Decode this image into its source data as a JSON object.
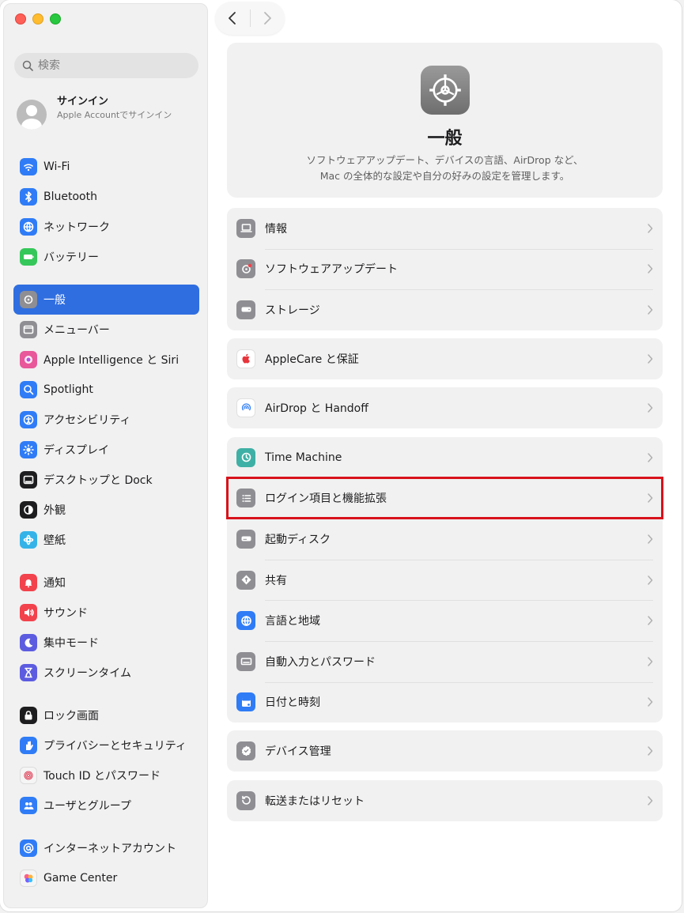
{
  "search": {
    "placeholder": "検索"
  },
  "account": {
    "title": "サインイン",
    "subtitle": "Apple Accountでサインイン"
  },
  "sidebar": {
    "groups": [
      [
        {
          "label": "Wi-Fi",
          "icon": "wifi-icon",
          "color": "#2f7cf6"
        },
        {
          "label": "Bluetooth",
          "icon": "bluetooth-icon",
          "color": "#2f7cf6"
        },
        {
          "label": "ネットワーク",
          "icon": "globe-icon",
          "color": "#2f7cf6"
        },
        {
          "label": "バッテリー",
          "icon": "battery-icon",
          "color": "#35c759"
        }
      ],
      [
        {
          "label": "一般",
          "icon": "gear-icon",
          "color": "#8e8e93",
          "active": true
        },
        {
          "label": "メニューバー",
          "icon": "menubar-icon",
          "color": "#8e8e93"
        },
        {
          "label": "Apple Intelligence と Siri",
          "icon": "siri-icon",
          "color": "#e8589a"
        },
        {
          "label": "Spotlight",
          "icon": "magnifier-icon",
          "color": "#2f7cf6"
        },
        {
          "label": "アクセシビリティ",
          "icon": "accessibility-icon",
          "color": "#2f7cf6"
        },
        {
          "label": "ディスプレイ",
          "icon": "sun-icon",
          "color": "#2f7cf6"
        },
        {
          "label": "デスクトップと Dock",
          "icon": "dock-icon",
          "color": "#1d1d1f"
        },
        {
          "label": "外観",
          "icon": "appearance-icon",
          "color": "#1d1d1f"
        },
        {
          "label": "壁紙",
          "icon": "flower-icon",
          "color": "#35b3e8"
        }
      ],
      [
        {
          "label": "通知",
          "icon": "bell-icon",
          "color": "#f2424c"
        },
        {
          "label": "サウンド",
          "icon": "speaker-icon",
          "color": "#f2424c"
        },
        {
          "label": "集中モード",
          "icon": "moon-icon",
          "color": "#5c5ce0"
        },
        {
          "label": "スクリーンタイム",
          "icon": "hourglass-icon",
          "color": "#5c5ce0"
        }
      ],
      [
        {
          "label": "ロック画面",
          "icon": "lock-icon",
          "color": "#1d1d1f"
        },
        {
          "label": "プライバシーとセキュリティ",
          "icon": "hand-icon",
          "color": "#2f7cf6"
        },
        {
          "label": "Touch ID とパスワード",
          "icon": "fingerprint-icon",
          "color": "#f5f5f5"
        },
        {
          "label": "ユーザとグループ",
          "icon": "users-icon",
          "color": "#2f7cf6"
        }
      ],
      [
        {
          "label": "インターネットアカウント",
          "icon": "at-icon",
          "color": "#2f7cf6"
        },
        {
          "label": "Game Center",
          "icon": "gamecenter-icon",
          "color": "#f5f5f5"
        }
      ]
    ]
  },
  "hero": {
    "title": "一般",
    "desc_line1": "ソフトウェアアップデート、デバイスの言語、AirDrop など、",
    "desc_line2": "Mac の全体的な設定や自分の好みの設定を管理します。"
  },
  "cards": [
    {
      "rows": [
        {
          "label": "情報",
          "icon": "laptop-icon"
        },
        {
          "label": "ソフトウェアアップデート",
          "icon": "gear-badge-icon"
        },
        {
          "label": "ストレージ",
          "icon": "drive-icon"
        }
      ]
    },
    {
      "rows": [
        {
          "label": "AppleCare と保証",
          "icon": "apple-icon"
        }
      ]
    },
    {
      "rows": [
        {
          "label": "AirDrop と Handoff",
          "icon": "airdrop-icon"
        }
      ]
    },
    {
      "rows": [
        {
          "label": "Time Machine",
          "icon": "timemachine-icon"
        },
        {
          "label": "ログイン項目と機能拡張",
          "icon": "list-icon"
        },
        {
          "label": "起動ディスク",
          "icon": "startup-disk-icon"
        },
        {
          "label": "共有",
          "icon": "sharing-icon"
        },
        {
          "label": "言語と地域",
          "icon": "language-globe-icon"
        },
        {
          "label": "自動入力とパスワード",
          "icon": "keyboard-icon"
        },
        {
          "label": "日付と時刻",
          "icon": "calendar-icon"
        }
      ]
    },
    {
      "rows": [
        {
          "label": "デバイス管理",
          "icon": "badge-check-icon"
        }
      ]
    },
    {
      "rows": [
        {
          "label": "転送またはリセット",
          "icon": "reset-icon"
        }
      ]
    }
  ]
}
